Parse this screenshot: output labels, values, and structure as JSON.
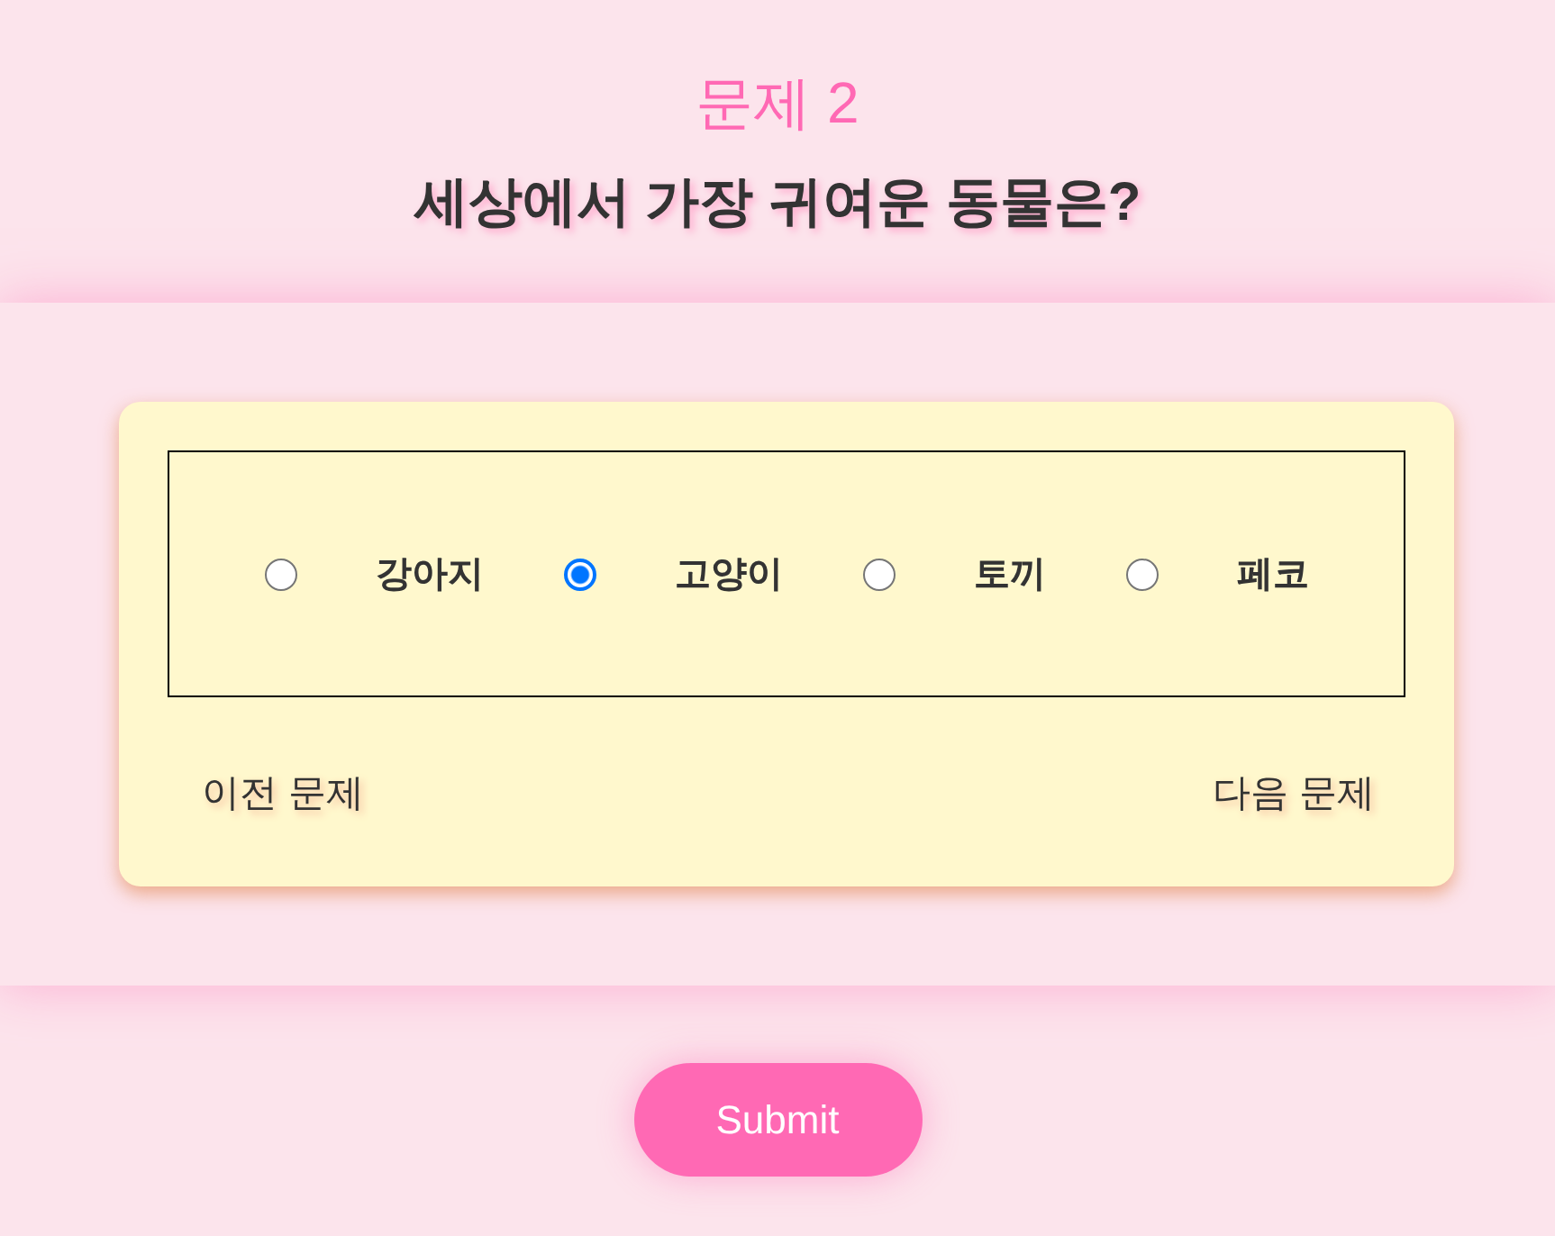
{
  "quiz": {
    "title": "문제 2",
    "question": "세상에서 가장 귀여운 동물은?"
  },
  "options": [
    {
      "label": "강아지",
      "selected": false
    },
    {
      "label": "고양이",
      "selected": true
    },
    {
      "label": "토끼",
      "selected": false
    },
    {
      "label": "페코",
      "selected": false
    }
  ],
  "navigation": {
    "previous": "이전 문제",
    "next": "다음 문제"
  },
  "submit_button": {
    "label": "Submit"
  }
}
